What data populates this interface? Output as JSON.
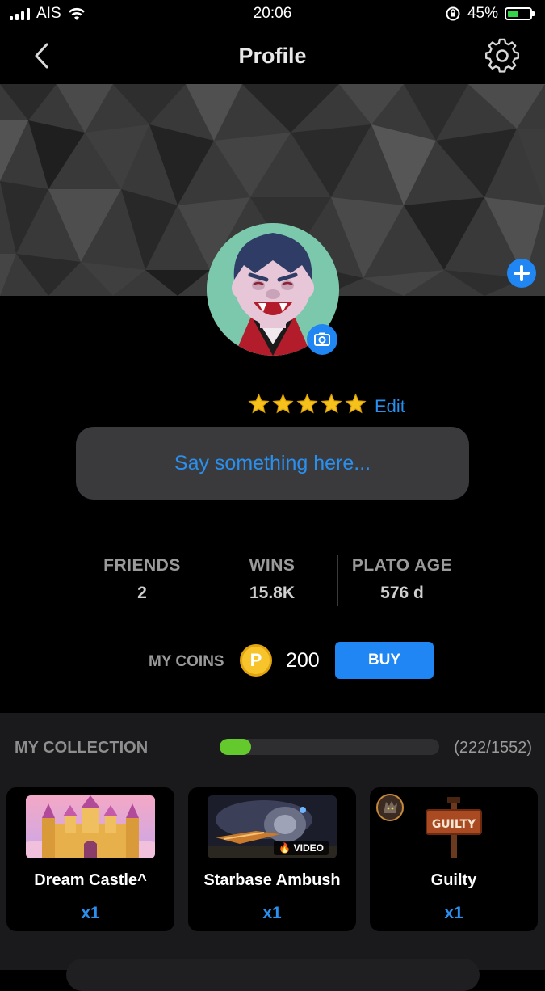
{
  "status_bar": {
    "carrier": "AIS",
    "time": "20:06",
    "battery": "45%",
    "battery_level": 0.45
  },
  "nav": {
    "title": "Profile"
  },
  "profile": {
    "rating_stars": 5,
    "edit_label": "Edit",
    "status_placeholder": "Say something here..."
  },
  "stats": [
    {
      "label": "FRIENDS",
      "value": "2"
    },
    {
      "label": "WINS",
      "value": "15.8K"
    },
    {
      "label": "PLATO AGE",
      "value": "576 d"
    }
  ],
  "coins": {
    "label": "MY COINS",
    "coin_symbol": "P",
    "value": "200",
    "buy_label": "BUY"
  },
  "collection": {
    "title": "MY COLLECTION",
    "count": "(222/1552)",
    "progress": 0.143,
    "items": [
      {
        "name": "Dream Castle^",
        "qty": "x1"
      },
      {
        "name": "Starbase Ambush",
        "qty": "x1",
        "tag": "VIDEO"
      },
      {
        "name": "Guilty",
        "qty": "x1",
        "sign_text": "GUILTY"
      }
    ]
  },
  "colors": {
    "accent": "#1f86f3",
    "progress": "#63c92d",
    "coin": "#f7c52b"
  }
}
